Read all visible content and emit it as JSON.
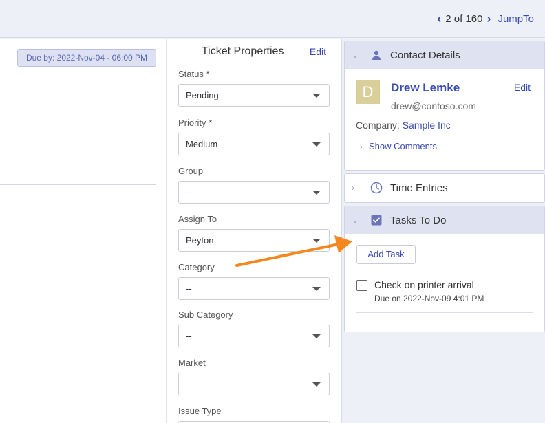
{
  "pager": {
    "position": "2 of 160",
    "jump_label": "JumpTo"
  },
  "left": {
    "due_badge": "Due by: 2022-Nov-04 - 06:00 PM"
  },
  "ticket_properties": {
    "title": "Ticket Properties",
    "edit_label": "Edit",
    "fields": [
      {
        "label": "Status",
        "required": "*",
        "value": "Pending"
      },
      {
        "label": "Priority",
        "required": "*",
        "value": "Medium"
      },
      {
        "label": "Group",
        "required": "",
        "value": "--"
      },
      {
        "label": "Assign To",
        "required": "",
        "value": "Peyton"
      },
      {
        "label": "Category",
        "required": "",
        "value": "--"
      },
      {
        "label": "Sub Category",
        "required": "",
        "value": "--"
      },
      {
        "label": "Market",
        "required": "",
        "value": ""
      },
      {
        "label": "Issue Type",
        "required": "",
        "value": ""
      }
    ]
  },
  "contact": {
    "header": "Contact Details",
    "avatar_letter": "D",
    "name": "Drew Lemke",
    "edit_label": "Edit",
    "email": "drew@contoso.com",
    "company_label": "Company:",
    "company_name": "Sample Inc",
    "show_comments": "Show Comments"
  },
  "time_entries": {
    "header": "Time Entries"
  },
  "tasks": {
    "header": "Tasks To Do",
    "add_label": "Add Task",
    "items": [
      {
        "title": "Check on printer arrival",
        "due": "Due on 2022-Nov-09 4:01 PM",
        "done": false
      }
    ]
  },
  "colors": {
    "accent": "#3a4bb5",
    "annotation_arrow": "#f5871f"
  }
}
